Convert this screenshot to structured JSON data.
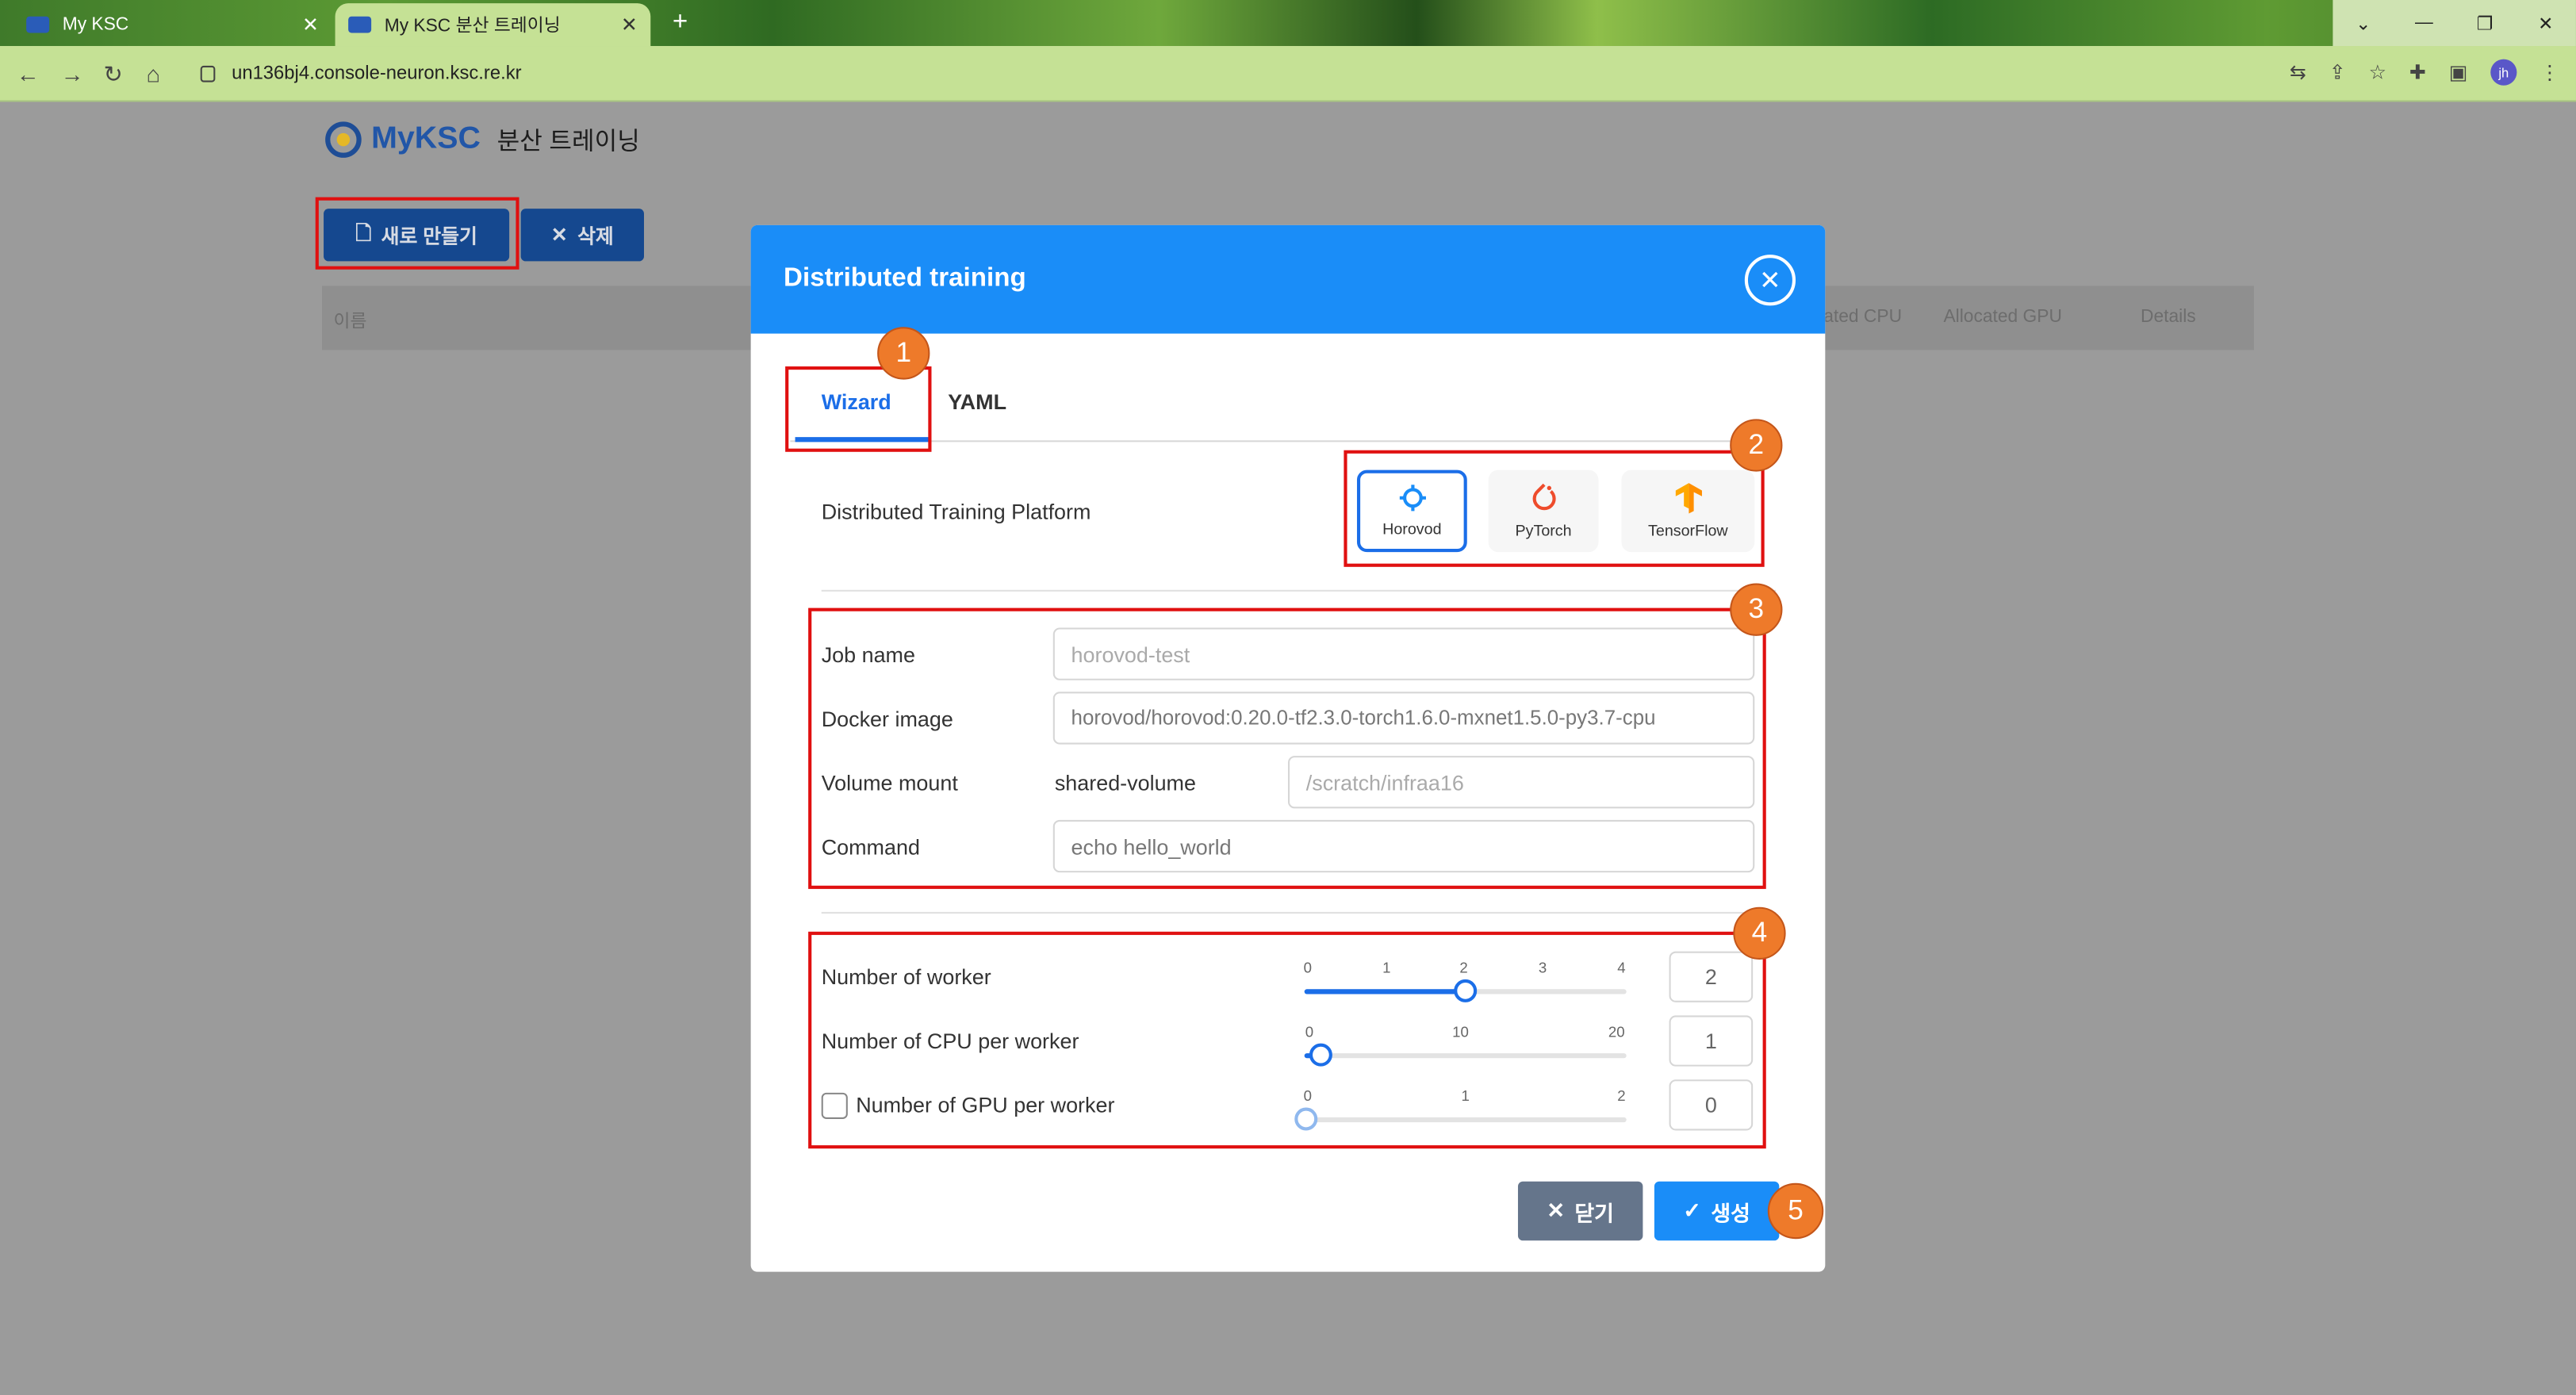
{
  "browser": {
    "tabs": [
      {
        "title": "My KSC"
      },
      {
        "title": "My KSC 분산 트레이닝"
      }
    ],
    "url": "un136bj4.console-neuron.ksc.re.kr",
    "profile_initials": "jh"
  },
  "app": {
    "brand": "MyKSC",
    "page_title": "분산 트레이닝",
    "toolbar": {
      "new_label": "새로 만들기",
      "delete_label": "삭제"
    },
    "table_headers": [
      "이름",
      "ated CPU",
      "Allocated GPU",
      "Details"
    ]
  },
  "modal": {
    "title": "Distributed training",
    "tabs": [
      {
        "label": "Wizard",
        "active": true
      },
      {
        "label": "YAML",
        "active": false
      }
    ],
    "platform_label": "Distributed Training Platform",
    "platforms": [
      {
        "name": "Horovod",
        "selected": true,
        "icon": "horovod-icon"
      },
      {
        "name": "PyTorch",
        "selected": false,
        "icon": "pytorch-icon"
      },
      {
        "name": "TensorFlow",
        "selected": false,
        "icon": "tensorflow-icon"
      }
    ],
    "fields": {
      "job_name": {
        "label": "Job name",
        "placeholder": "horovod-test"
      },
      "docker_image": {
        "label": "Docker image",
        "value": "horovod/horovod:0.20.0-tf2.3.0-torch1.6.0-mxnet1.5.0-py3.7-cpu"
      },
      "volume_mount": {
        "label": "Volume mount",
        "volume": "shared-volume",
        "placeholder": "/scratch/infraa16"
      },
      "command": {
        "label": "Command",
        "value": "echo hello_world"
      }
    },
    "sliders": {
      "workers": {
        "label": "Number of worker",
        "ticks": [
          "0",
          "1",
          "2",
          "3",
          "4"
        ],
        "value": "2"
      },
      "cpu": {
        "label": "Number of CPU per worker",
        "ticks": [
          "0",
          "10",
          "20"
        ],
        "value": "1"
      },
      "gpu": {
        "label": "Number of GPU per worker",
        "ticks": [
          "0",
          "1",
          "2"
        ],
        "value": "0",
        "enabled": false
      }
    },
    "buttons": {
      "close_label": "닫기",
      "create_label": "생성"
    },
    "annotations": [
      "1",
      "2",
      "3",
      "4",
      "5"
    ]
  },
  "colors": {
    "primary": "#1a8df8",
    "highlight": "#e01010",
    "badge": "#ee7a2a",
    "nav_button": "#15488f"
  }
}
